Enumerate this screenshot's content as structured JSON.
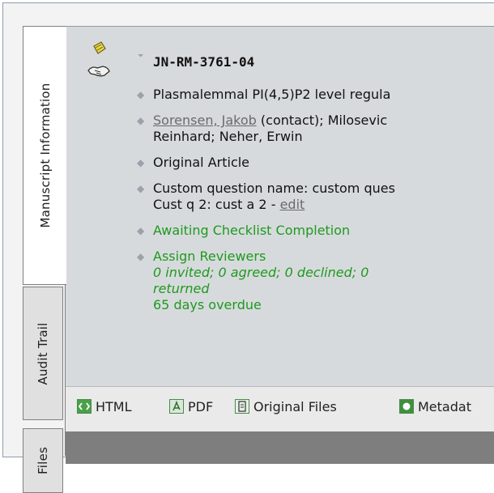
{
  "tabs": {
    "manuscript": "Manuscript Information",
    "audit": "Audit Trail",
    "files": "Files"
  },
  "manuscript": {
    "id": "JN-RM-3761-04",
    "title": "Plasmalemmal PI(4,5)P2 level regula",
    "authors_link": "Sorensen, Jakob",
    "authors_rest1": " (contact); Milosevic",
    "authors_rest2": "Reinhard; Neher, Erwin",
    "article_type": "Original Article",
    "custom_q1": "Custom question name: custom ques",
    "custom_q2_prefix": "Cust q 2: cust a 2 - ",
    "edit": "edit",
    "status": "Awaiting Checklist Completion",
    "assign": "Assign Reviewers",
    "review_counts_1": "0 invited; 0 agreed; 0 declined; 0",
    "review_counts_2": "returned",
    "overdue": "65 days overdue"
  },
  "footer": {
    "html": "HTML",
    "pdf": "PDF",
    "original": "Original Files",
    "metadata": "Metadat"
  },
  "colors": {
    "green": "#1e9a1e",
    "panel": "#d7dadd"
  }
}
